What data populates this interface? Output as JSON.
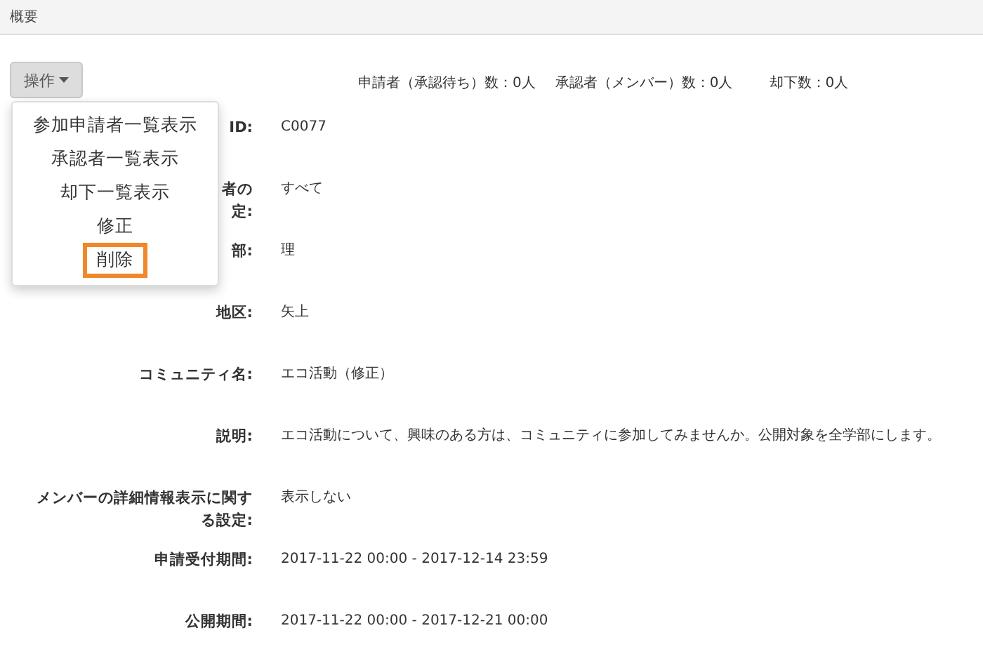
{
  "header": {
    "title": "概要"
  },
  "action_button": {
    "label": "操作"
  },
  "counts": [
    "申請者（承認待ち）数：0人",
    "承認者（メンバー）数：0人",
    "却下数：0人"
  ],
  "menu": {
    "items": [
      {
        "label": "参加申請者一覧表示",
        "selected": false
      },
      {
        "label": "承認者一覧表示",
        "selected": false
      },
      {
        "label": "却下一覧表示",
        "selected": false
      },
      {
        "label": "修正",
        "selected": false
      },
      {
        "label": "削除",
        "selected": true
      }
    ]
  },
  "fields": [
    {
      "label": "ID:",
      "value": "C0077"
    },
    {
      "label": "者の",
      "label_2": "定:",
      "value": "すべて"
    },
    {
      "label": "部:",
      "value": "理"
    },
    {
      "label": "地区:",
      "value": "矢上"
    },
    {
      "label": "コミュニティ名:",
      "value": "エコ活動（修正）"
    },
    {
      "label": "説明:",
      "value": "エコ活動について、興味のある方は、コミュニティに参加してみませんか。公開対象を全学部にします。"
    },
    {
      "label": "メンバーの詳細情報表示に関する設定:",
      "value": "表示しない"
    },
    {
      "label": "申請受付期間:",
      "value": "2017-11-22 00:00 - 2017-12-14 23:59"
    },
    {
      "label": "公開期間:",
      "value": "2017-11-22 00:00 - 2017-12-21 00:00"
    }
  ]
}
